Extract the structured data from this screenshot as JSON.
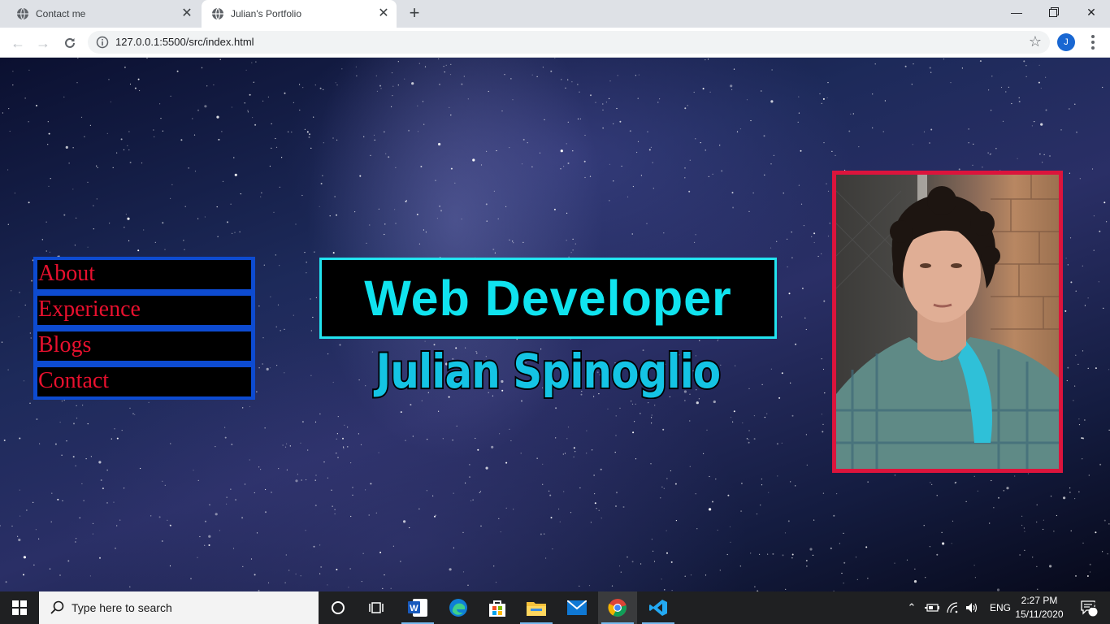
{
  "browser": {
    "tabs": [
      {
        "title": "Contact me",
        "active": false
      },
      {
        "title": "Julian's Portfolio",
        "active": true
      }
    ],
    "url": "127.0.0.1:5500/src/index.html",
    "profile_initial": "J"
  },
  "page": {
    "nav": {
      "items": [
        "About",
        "Experience",
        "Blogs",
        "Contact"
      ]
    },
    "hero": {
      "role": "Web Developer",
      "name": "Julian Spinoglio"
    },
    "colors": {
      "nav_border": "#0d4bd1",
      "nav_text": "#e8102e",
      "hero_cyan": "#10e3ef",
      "photo_border": "#dc143c"
    }
  },
  "taskbar": {
    "search_placeholder": "Type here to search",
    "apps": [
      "task-view",
      "word",
      "edge",
      "store",
      "file-explorer",
      "mail",
      "chrome",
      "vscode"
    ],
    "language": "ENG",
    "time": "2:27 PM",
    "date": "15/11/2020",
    "notification_count": "2"
  }
}
